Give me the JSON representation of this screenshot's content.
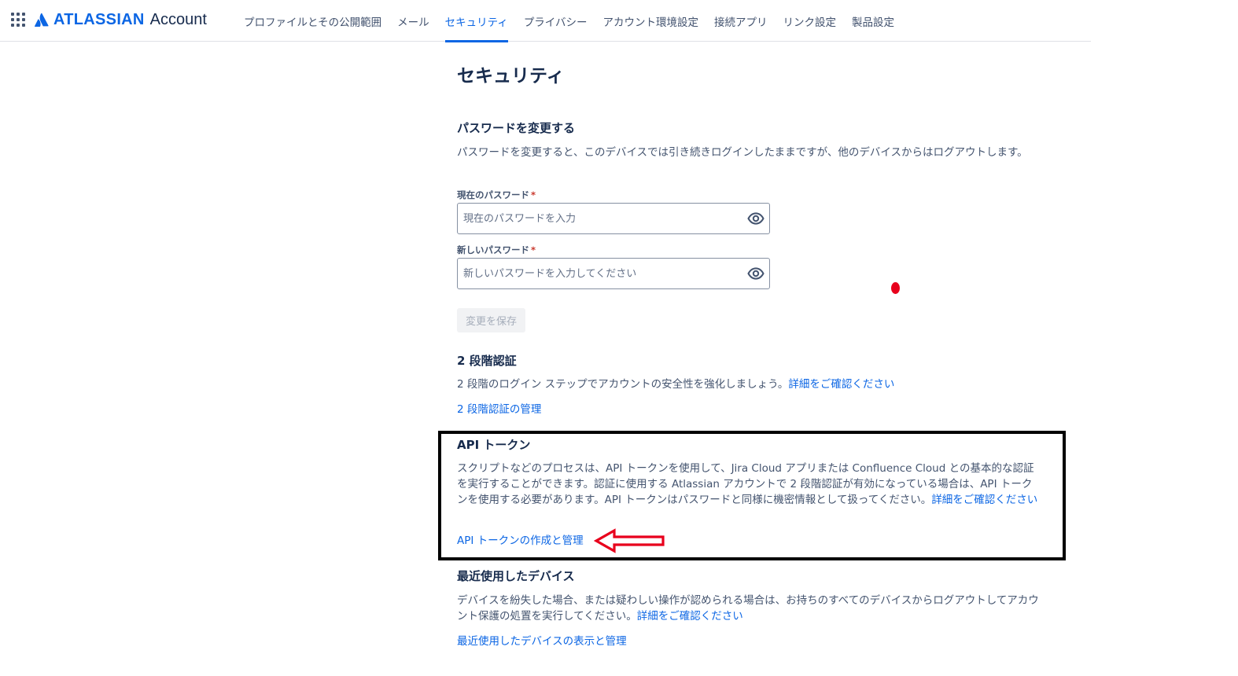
{
  "header": {
    "brand_word": "ATLASSIAN",
    "brand_product": "Account",
    "tabs": [
      {
        "label": "プロファイルとその公開範囲"
      },
      {
        "label": "メール"
      },
      {
        "label": "セキュリティ",
        "active": true
      },
      {
        "label": "プライバシー"
      },
      {
        "label": "アカウント環境設定"
      },
      {
        "label": "接続アプリ"
      },
      {
        "label": "リンク設定"
      },
      {
        "label": "製品設定"
      }
    ]
  },
  "page": {
    "title": "セキュリティ"
  },
  "password": {
    "title": "パスワードを変更する",
    "description": "パスワードを変更すると、このデバイスでは引き続きログインしたままですが、他のデバイスからはログアウトします。",
    "current_label": "現在のパスワード",
    "current_placeholder": "現在のパスワードを入力",
    "new_label": "新しいパスワード",
    "new_placeholder": "新しいパスワードを入力してください",
    "required_mark": "*",
    "save_label": "変更を保存"
  },
  "two_step": {
    "title": "2 段階認証",
    "description": "2 段階のログイン ステップでアカウントの安全性を強化しましょう。",
    "learn_more": "詳細をご確認ください",
    "manage_link": "2 段階認証の管理"
  },
  "api_tokens": {
    "title": "API トークン",
    "description": "スクリプトなどのプロセスは、API トークンを使用して、Jira Cloud アプリまたは Confluence Cloud との基本的な認証を実行することができます。認証に使用する Atlassian アカウントで 2 段階認証が有効になっている場合は、API トークンを使用する必要があります。API トークンはパスワードと同様に機密情報として扱ってください。",
    "learn_more": "詳細をご確認ください",
    "manage_link": "API トークンの作成と管理"
  },
  "devices": {
    "title": "最近使用したデバイス",
    "description": "デバイスを紛失した場合、または疑わしい操作が認められる場合は、お持ちのすべてのデバイスからログアウトしてアカウント保護の処置を実行してください。",
    "learn_more": "詳細をご確認ください",
    "manage_link": "最近使用したデバイスの表示と管理"
  },
  "colors": {
    "brand_blue": "#0c66e4",
    "text": "#172b4d",
    "subtle_text": "#44546f",
    "annotation_black": "#000000",
    "annotation_red": "#e8001c"
  },
  "icons": {
    "app_switcher": "grid-dots-icon",
    "brand": "atlassian-logo-icon",
    "password_toggle": "eye-icon",
    "annotation": "red-arrow-icon"
  }
}
